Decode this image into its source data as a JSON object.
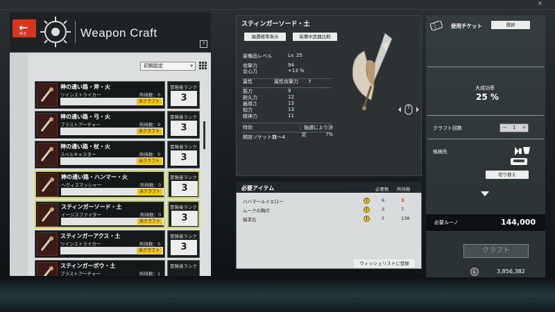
{
  "header": {
    "back_label": "戻る",
    "title": "Weapon Craft",
    "help": "?"
  },
  "sort": {
    "value": "初期設定",
    "caret": "▾"
  },
  "weapons": [
    {
      "name": "神の通い路・斧・火",
      "type": "ツインストライカー",
      "owned": "所持数：0",
      "status": "未クラフト",
      "rank_label": "冒険者ランク",
      "rank": "3",
      "selected": false
    },
    {
      "name": "神の通い路・弓・火",
      "type": "ブラストアーチャー",
      "owned": "所持数：0",
      "status": "未クラフト",
      "rank_label": "冒険者ランク",
      "rank": "3",
      "selected": false
    },
    {
      "name": "神の通い路・杖・火",
      "type": "スペルキャスター",
      "owned": "所持数：0",
      "status": "未クラフト",
      "rank_label": "冒険者ランク",
      "rank": "3",
      "selected": false
    },
    {
      "name": "神の通い路・ハンマー・火",
      "type": "ヘヴィスマッシャー",
      "owned": "所持数：0",
      "status": "未クラフト",
      "rank_label": "冒険者ランク",
      "rank": "3",
      "selected": true
    },
    {
      "name": "スティンガーソード・土",
      "type": "イージスファイター",
      "owned": "所持数：0",
      "status": "未クラフト",
      "rank_label": "冒険者ランク",
      "rank": "3",
      "selected": true
    },
    {
      "name": "スティンガーアクス・土",
      "type": "ツインストライカー",
      "owned": "所持数：0",
      "status": "未クラフト",
      "rank_label": "冒険者ランク",
      "rank": "3",
      "selected": false
    },
    {
      "name": "スティンガーボウ・土",
      "type": "ブラストアーチャー",
      "owned": "所持数：1",
      "status": "",
      "rank_label": "冒険者ランク",
      "rank": "",
      "selected": false
    }
  ],
  "detail": {
    "title": "スティンガーソード・土",
    "btn_rates": "抽選確率表示",
    "btn_compare": "装備中武器比較",
    "stats": [
      {
        "label": "装備品レベル",
        "value": "Lv. 25"
      },
      {
        "label": "攻撃力",
        "value": "94"
      },
      {
        "label": "会心力",
        "value": "+13 %"
      },
      {
        "label": "属性",
        "value": "属性攻撃力　　7"
      },
      {
        "label": "筋力",
        "value": "9"
      },
      {
        "label": "耐久力",
        "value": "12"
      },
      {
        "label": "器用さ",
        "value": "13"
      },
      {
        "label": "知力",
        "value": "13"
      },
      {
        "label": "精神力",
        "value": "11"
      },
      {
        "label": "特効",
        "value": "：抽選により決定　　　　?%"
      },
      {
        "label": "開放ソケット数",
        "value": "1〜4"
      }
    ]
  },
  "required": {
    "title": "必要アイテム",
    "col_need": "必要数",
    "col_have": "所持数",
    "items": [
      {
        "name": "バハマールイエロー",
        "need": "6",
        "have": "3",
        "short": true
      },
      {
        "name": "ムークの胸爪",
        "need": "3",
        "have": "7",
        "short": false
      },
      {
        "name": "探求石",
        "need": "5",
        "have": "138",
        "short": false
      }
    ],
    "wishlist": "ウィッシュリストに登録",
    "coin_glyph": "!"
  },
  "right": {
    "ticket_label": "使用チケット",
    "select_btn": "選択",
    "success_label": "大成功率",
    "success_value": "25 %",
    "craft_count_label": "クラフト回数",
    "count_minus": "－",
    "count_value": "1",
    "count_plus": "＋",
    "dest_label": "格納先",
    "switch_btn": "切り替え",
    "rune_label": "必要ルーノ",
    "rune_value": "144,000",
    "craft_btn": "クラフト",
    "money_value": "3,856,382"
  },
  "colors": {
    "accent_red": "#d8351f",
    "select_outline": "#c9d24a",
    "status_yellow": "#f2c300",
    "short_red": "#d8351f"
  },
  "icons": [
    "back-arrow-icon",
    "emblem-icon",
    "help-icon",
    "grid-view-icon",
    "weapon-icon",
    "ticket-icon",
    "rotate-view-icon",
    "storage-icon",
    "coin-icon",
    "money-icon",
    "close-icon"
  ]
}
